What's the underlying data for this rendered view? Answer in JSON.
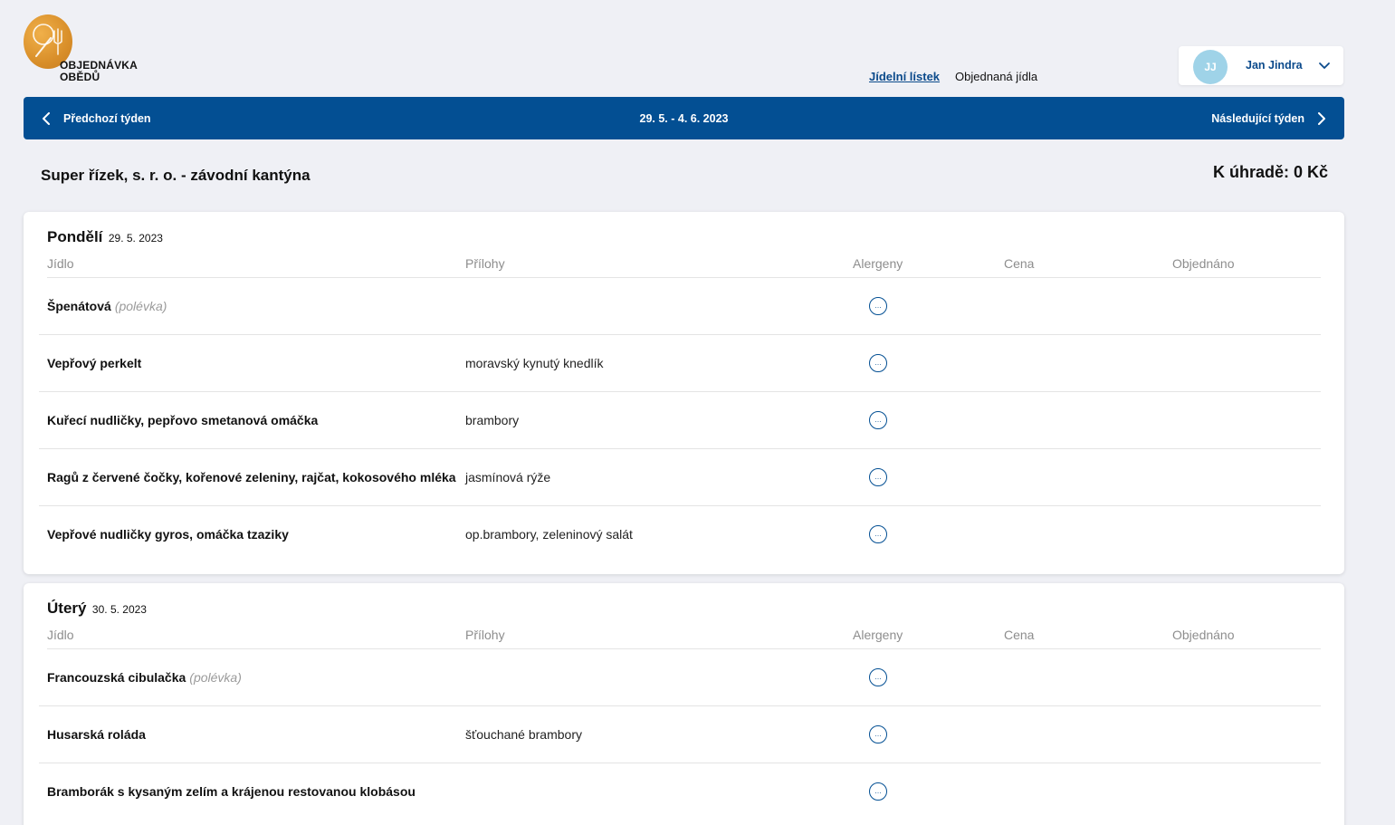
{
  "brand": {
    "line1": "OBJEDNÁVKA",
    "line2": "OBĚDŮ",
    "accent": "#d98f2a"
  },
  "nav": {
    "menu_link": "Jídelní lístek",
    "ordered_link": "Objednaná jídla"
  },
  "user": {
    "initials": "JJ",
    "name": "Jan Jindra"
  },
  "week": {
    "prev": "Předchozí týden",
    "range": "29. 5. - 4. 6. 2023",
    "next": "Následující týden",
    "color": "#034f93"
  },
  "canteen": "Super řízek, s. r. o. - závodní kantýna",
  "to_pay": "K úhradě: 0 Kč",
  "columns": {
    "meal": "Jídlo",
    "sides": "Přílohy",
    "allergens": "Alergeny",
    "price": "Cena",
    "ordered": "Objednáno"
  },
  "allergen_icon": "…",
  "days": [
    {
      "name": "Pondělí",
      "date": "29. 5. 2023",
      "rows": [
        {
          "meal": "Špenátová",
          "tag": "(polévka)",
          "side": ""
        },
        {
          "meal": "Vepřový perkelt",
          "tag": "",
          "side": "moravský kynutý knedlík"
        },
        {
          "meal": "Kuřecí nudličky, pepřovo smetanová omáčka",
          "tag": "",
          "side": "brambory"
        },
        {
          "meal": "Ragů z červené čočky, kořenové zeleniny, rajčat, kokosového mléka",
          "tag": "",
          "side": "jasmínová rýže"
        },
        {
          "meal": "Vepřové nudličky gyros, omáčka tzaziky",
          "tag": "",
          "side": "op.brambory, zeleninový salát"
        }
      ]
    },
    {
      "name": "Úterý",
      "date": "30. 5. 2023",
      "rows": [
        {
          "meal": "Francouzská cibulačka",
          "tag": "(polévka)",
          "side": ""
        },
        {
          "meal": "Husarská roláda",
          "tag": "",
          "side": "šťouchané brambory"
        },
        {
          "meal": "Bramborák s kysaným zelím a krájenou restovanou klobásou",
          "tag": "",
          "side": ""
        }
      ]
    }
  ]
}
